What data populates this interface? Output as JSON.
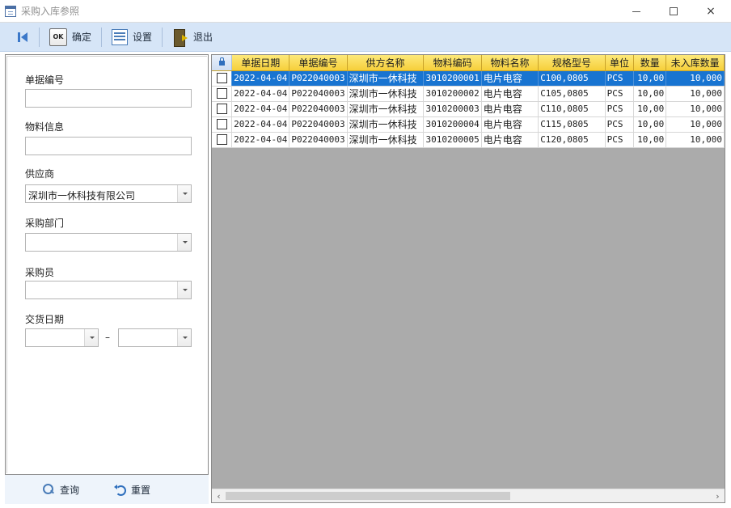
{
  "window": {
    "title": "采购入库参照",
    "controls": {
      "minimize": "minimize",
      "maximize": "maximize",
      "close": "×"
    }
  },
  "toolbar": {
    "ok_label": "确定",
    "ok_icon_text": "OK",
    "settings_label": "设置",
    "exit_label": "退出"
  },
  "filters": {
    "doc_no_label": "单据编号",
    "doc_no_value": "",
    "material_label": "物料信息",
    "material_value": "",
    "supplier_label": "供应商",
    "supplier_value": "深圳市一休科技有限公司",
    "dept_label": "采购部门",
    "dept_value": "",
    "buyer_label": "采购员",
    "buyer_value": "",
    "delivery_date_label": "交货日期",
    "date_from": "",
    "date_to": "",
    "date_separator": "–"
  },
  "left_footer": {
    "query_label": "查询",
    "reset_label": "重置"
  },
  "grid": {
    "columns": [
      "单据日期",
      "单据编号",
      "供方名称",
      "物料编码",
      "物料名称",
      "规格型号",
      "单位",
      "数量",
      "未入库数量"
    ],
    "rows": [
      {
        "date": "2022-04-04",
        "doc_no": "P022040003",
        "supplier": "深圳市一休科技",
        "code": "3010200001",
        "name": "电片电容",
        "spec": "C100,0805",
        "unit": "PCS",
        "qty": "10,00",
        "pending": "10,000"
      },
      {
        "date": "2022-04-04",
        "doc_no": "P022040003",
        "supplier": "深圳市一休科技",
        "code": "3010200002",
        "name": "电片电容",
        "spec": "C105,0805",
        "unit": "PCS",
        "qty": "10,00",
        "pending": "10,000"
      },
      {
        "date": "2022-04-04",
        "doc_no": "P022040003",
        "supplier": "深圳市一休科技",
        "code": "3010200003",
        "name": "电片电容",
        "spec": "C110,0805",
        "unit": "PCS",
        "qty": "10,00",
        "pending": "10,000"
      },
      {
        "date": "2022-04-04",
        "doc_no": "P022040003",
        "supplier": "深圳市一休科技",
        "code": "3010200004",
        "name": "电片电容",
        "spec": "C115,0805",
        "unit": "PCS",
        "qty": "10,00",
        "pending": "10,000"
      },
      {
        "date": "2022-04-04",
        "doc_no": "P022040003",
        "supplier": "深圳市一休科技",
        "code": "3010200005",
        "name": "电片电容",
        "spec": "C120,0805",
        "unit": "PCS",
        "qty": "10,00",
        "pending": "10,000"
      }
    ],
    "selected_row": 0,
    "scroll_left_arrow": "‹",
    "scroll_right_arrow": "›"
  },
  "colors": {
    "toolbar_bg": "#d6e5f7",
    "header_bg": "#f6cf3a",
    "selection": "#1874d1",
    "grid_empty": "#ababab"
  }
}
